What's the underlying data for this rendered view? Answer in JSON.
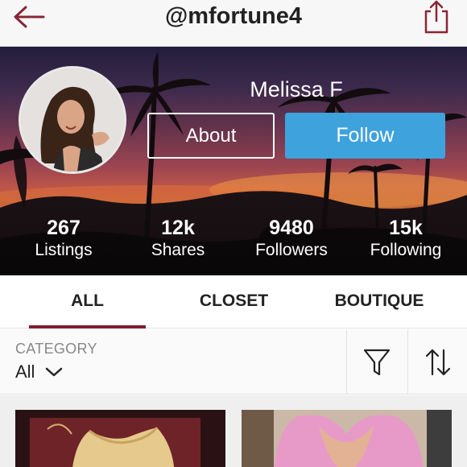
{
  "header": {
    "username": "@mfortune4",
    "back_icon": "arrow-left-icon",
    "share_icon": "share-icon",
    "accent_color": "#7f1d2e"
  },
  "profile": {
    "display_name": "Melissa F",
    "about_label": "About",
    "follow_label": "Follow",
    "follow_color": "#3ea3dd"
  },
  "stats": [
    {
      "value": "267",
      "label": "Listings"
    },
    {
      "value": "12k",
      "label": "Shares"
    },
    {
      "value": "9480",
      "label": "Followers"
    },
    {
      "value": "15k",
      "label": "Following"
    }
  ],
  "tabs": {
    "items": [
      "ALL",
      "CLOSET",
      "BOUTIQUE"
    ],
    "active": "ALL"
  },
  "filters": {
    "category_label": "CATEGORY",
    "category_value": "All",
    "filter_icon": "funnel-icon",
    "sort_icon": "sort-arrows-icon"
  }
}
